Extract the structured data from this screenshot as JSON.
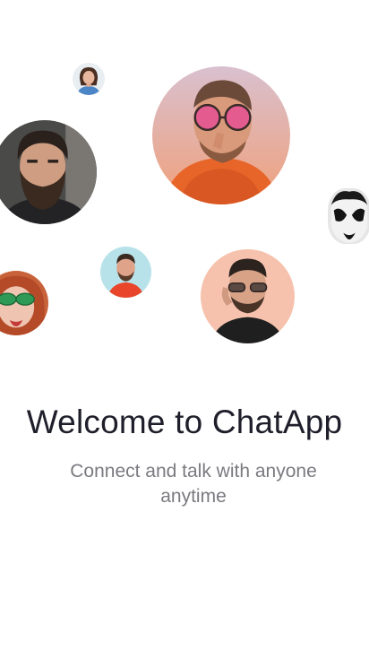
{
  "welcome": {
    "title": "Welcome to ChatApp",
    "subtitle": "Connect and talk with anyone anytime"
  },
  "avatars": [
    {
      "name": "avatar-woman-small",
      "icon": "person-photo-icon"
    },
    {
      "name": "avatar-man-pink-glasses",
      "icon": "person-photo-icon"
    },
    {
      "name": "avatar-bearded-man",
      "icon": "person-photo-icon"
    },
    {
      "name": "avatar-face-paint",
      "icon": "person-photo-icon"
    },
    {
      "name": "avatar-man-red-shirt",
      "icon": "person-photo-icon"
    },
    {
      "name": "avatar-man-sunglasses",
      "icon": "person-photo-icon"
    },
    {
      "name": "avatar-woman-green-glasses",
      "icon": "person-photo-icon"
    }
  ],
  "colors": {
    "background": "#ffffff",
    "title": "#1f1f2b",
    "subtitle": "#7a7a80"
  }
}
